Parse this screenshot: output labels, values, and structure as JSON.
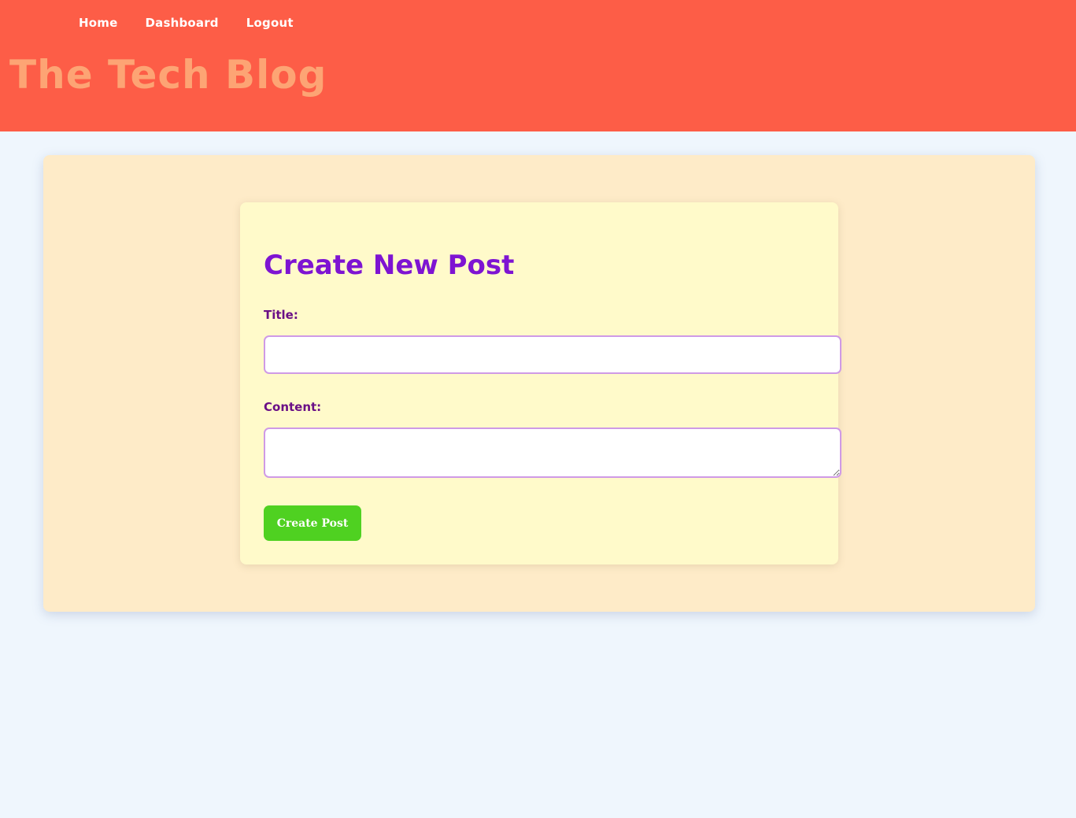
{
  "header": {
    "nav": [
      {
        "label": "Home"
      },
      {
        "label": "Dashboard"
      },
      {
        "label": "Logout"
      }
    ],
    "site_title": "The Tech Blog"
  },
  "form": {
    "heading": "Create New Post",
    "title_label": "Title:",
    "title_value": "",
    "content_label": "Content:",
    "content_value": "",
    "submit_label": "Create Post"
  },
  "colors": {
    "header_bg": "#fd5d47",
    "site_title": "#fda474",
    "page_bg": "#eff6fd",
    "outer_card_bg": "#feebc8",
    "form_card_bg": "#fffaca",
    "heading": "#7e14d2",
    "label": "#6a0f86",
    "field_border": "#cf9ae6",
    "button_bg": "#4fd121"
  }
}
